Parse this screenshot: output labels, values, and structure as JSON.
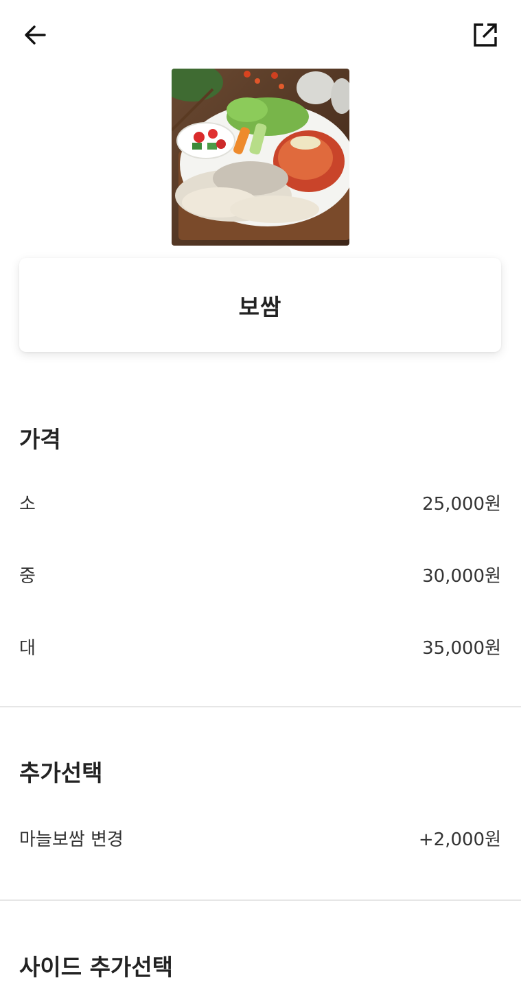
{
  "header": {
    "back_icon": "arrow-left-icon",
    "share_icon": "share-external-icon"
  },
  "menu": {
    "image_description": "bossam",
    "name": "보쌈"
  },
  "price_section": {
    "title": "가격",
    "options": [
      {
        "label": "소",
        "price": "25,000원"
      },
      {
        "label": "중",
        "price": "30,000원"
      },
      {
        "label": "대",
        "price": "35,000원"
      }
    ]
  },
  "extra_section": {
    "title": "추가선택",
    "options": [
      {
        "label": "마늘보쌈 변경",
        "price": "+2,000원"
      }
    ]
  },
  "side_section": {
    "title": "사이드 추가선택"
  }
}
